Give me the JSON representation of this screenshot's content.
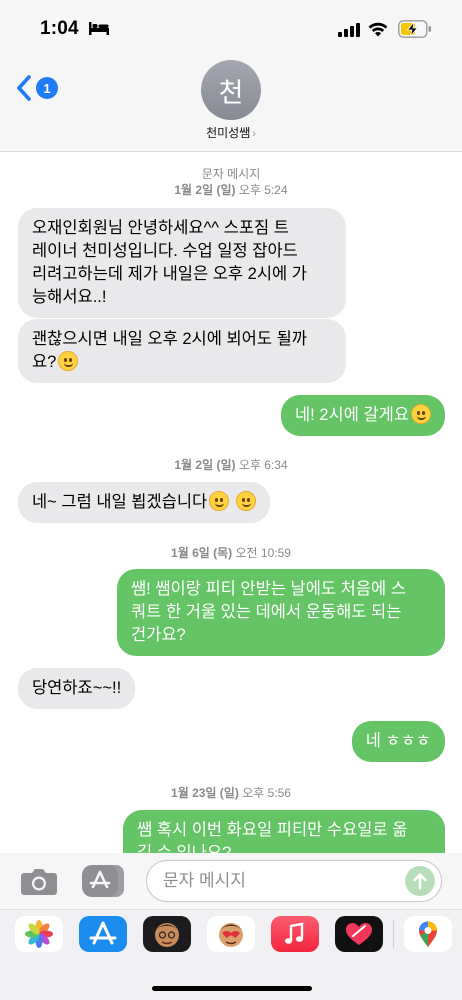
{
  "status_bar": {
    "time": "1:04"
  },
  "header": {
    "back_count": "1",
    "avatar_initial": "천",
    "contact_name": "천미성쌤"
  },
  "messages": {
    "service_label": "문자 메시지",
    "ts1_day": "1월 2일 (일)",
    "ts1_time": "오후 5:24",
    "m1_l1": "오재인회원님 안녕하세요^^ 스포짐 트",
    "m1_l2": "레이너 천미성입니다. 수업 일정 잡아드",
    "m1_l3": "리려고하는데 제가 내일은 오후 2시에 가",
    "m1_l4": "능해서요..!",
    "m2_l1": "괜찮으시면 내일 오후 2시에 뵈어도 될까",
    "m2_l2": "요?",
    "m3": "네! 2시에 갈게요",
    "ts2_day": "1월 2일 (일)",
    "ts2_time": "오후 6:34",
    "m4": "네~ 그럼 내일 뵙겠습니다",
    "ts3_day": "1월 6일 (목)",
    "ts3_time": "오전 10:59",
    "m5_l1": "쌤! 쌤이랑 피티 안받는 날에도 처음에 스",
    "m5_l2": "쿼트 한 거울 있는 데에서 운동해도 되는",
    "m5_l3": "건가요?",
    "m6": "당연하죠~~!!",
    "m7": "네 ㅎㅎㅎ",
    "ts4_day": "1월 23일 (일)",
    "ts4_time": "오후 5:56",
    "m8_l1": "쌤 혹시 이번 화요일 피티만 수요일로 옮",
    "m8_l2": "길 수 있나요?"
  },
  "composer": {
    "placeholder": "문자 메시지"
  },
  "apps": [
    "photos-icon",
    "app-store-icon",
    "memoji-icon",
    "memoji-stickers-icon",
    "music-icon",
    "digital-touch-icon",
    "maps-icon"
  ],
  "colors": {
    "incoming": "#e9e9eb",
    "outgoing": "#65c466",
    "accent": "#1f7cf5"
  }
}
